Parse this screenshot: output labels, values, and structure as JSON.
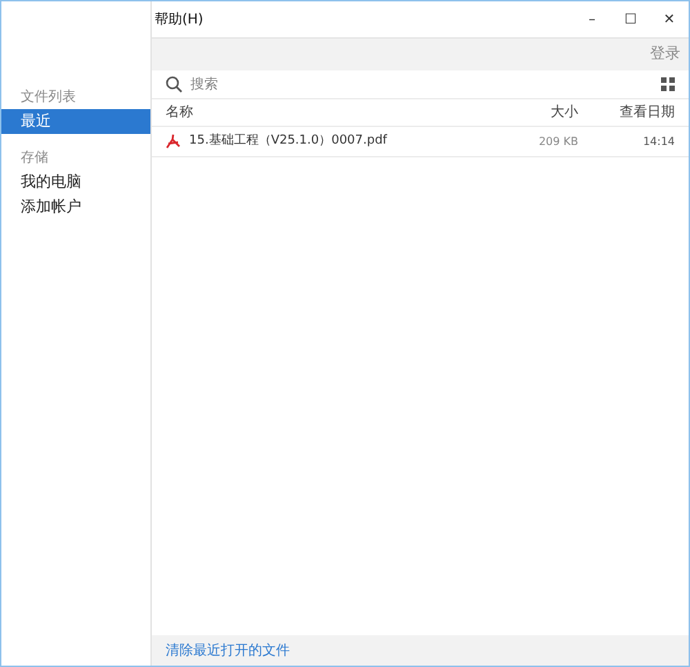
{
  "menu": [
    {
      "label": "帮助(H)"
    }
  ],
  "window_controls": [
    "–",
    "☐",
    "✕"
  ],
  "toolbar": {
    "login": "登录"
  },
  "sidebar": {
    "sections": [
      {
        "title": "文件列表",
        "items": [
          {
            "label": "最近",
            "selected": true
          }
        ]
      },
      {
        "title": "存储",
        "items": [
          {
            "label": "我的电脑",
            "selected": false
          },
          {
            "label": "添加帐户",
            "selected": false
          }
        ]
      }
    ]
  },
  "search": {
    "placeholder": "搜索"
  },
  "table": {
    "columns": [
      "名称",
      "大小",
      "查看日期"
    ],
    "rows": [
      {
        "name": "15.基础工程（V25.1.0）0007.pdf",
        "size": "209 KB",
        "date": "14:14"
      }
    ]
  },
  "footer": {
    "link": "清除最近打开的文件"
  }
}
